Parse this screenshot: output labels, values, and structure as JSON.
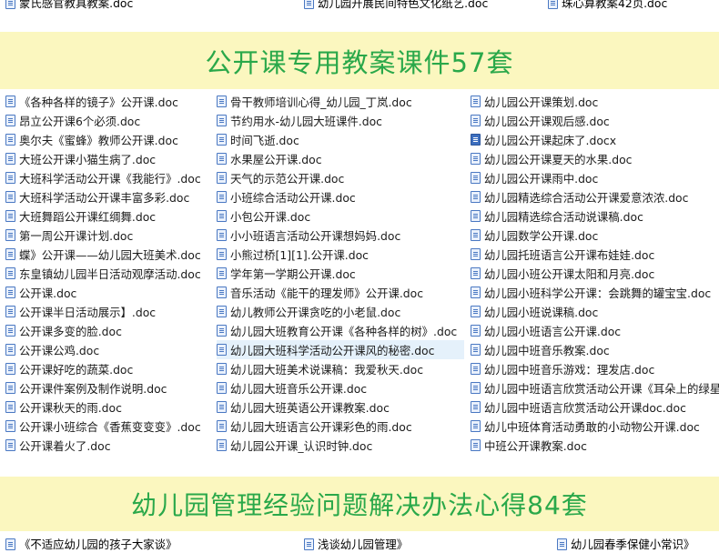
{
  "top_strip": [
    {
      "icon": "doc-file-icon",
      "text": "蒙氏感官教具教案.doc"
    },
    {
      "icon": "doc-file-icon",
      "text": "幼儿园开展民间特色文化纸艺.doc"
    },
    {
      "icon": "doc-file-icon",
      "text": "珠心算教案42页.doc"
    }
  ],
  "section_1": {
    "title": "公开课专用教案课件57套"
  },
  "columns": [
    [
      {
        "icon": "doc-file-icon",
        "text": "《各种各样的镜子》公开课.doc"
      },
      {
        "icon": "doc-file-icon",
        "text": "昂立公开课6个必须.doc"
      },
      {
        "icon": "doc-file-icon",
        "text": "奥尔夫《蜜蜂》教师公开课.doc"
      },
      {
        "icon": "doc-file-icon",
        "text": "大班公开课小猫生病了.doc"
      },
      {
        "icon": "doc-file-icon",
        "text": "大班科学活动公开课《我能行》.doc"
      },
      {
        "icon": "doc-file-icon",
        "text": "大班科学活动公开课丰富多彩.doc"
      },
      {
        "icon": "doc-file-icon",
        "text": "大班舞蹈公开课红绸舞.doc"
      },
      {
        "icon": "doc-file-icon",
        "text": "第一周公开课计划.doc"
      },
      {
        "icon": "doc-file-icon",
        "text": "蝶》公开课——幼儿园大班美术.doc"
      },
      {
        "icon": "doc-file-icon",
        "text": "东皇镇幼儿园半日活动观摩活动.doc"
      },
      {
        "icon": "doc-file-icon",
        "text": "公开课.doc"
      },
      {
        "icon": "doc-file-icon",
        "text": "公开课半日活动展示】.doc"
      },
      {
        "icon": "doc-file-icon",
        "text": "公开课多变的脸.doc"
      },
      {
        "icon": "doc-file-icon",
        "text": "公开课公鸡.doc"
      },
      {
        "icon": "doc-file-icon",
        "text": "公开课好吃的蔬菜.doc"
      },
      {
        "icon": "doc-file-icon",
        "text": "公开课件案例及制作说明.doc"
      },
      {
        "icon": "doc-file-icon",
        "text": "公开课秋天的雨.doc"
      },
      {
        "icon": "doc-file-icon",
        "text": "公开课小班综合《香蕉变变变》.doc"
      },
      {
        "icon": "doc-file-icon",
        "text": "公开课着火了.doc"
      }
    ],
    [
      {
        "icon": "doc-file-icon",
        "text": "骨干教师培训心得_幼儿园_丁岚.doc"
      },
      {
        "icon": "doc-file-icon",
        "text": "节约用水-幼儿园大班课件.doc"
      },
      {
        "icon": "doc-file-icon",
        "text": "时间飞逝.doc"
      },
      {
        "icon": "doc-file-icon",
        "text": "水果屋公开课.doc"
      },
      {
        "icon": "doc-file-icon",
        "text": "天气的示范公开课.doc"
      },
      {
        "icon": "doc-file-icon",
        "text": "小班综合活动公开课.doc"
      },
      {
        "icon": "doc-file-icon",
        "text": "小包公开课.doc"
      },
      {
        "icon": "doc-file-icon",
        "text": "小小班语言活动公开课想妈妈.doc"
      },
      {
        "icon": "doc-file-icon",
        "text": "小熊过桥[1][1].公开课.doc"
      },
      {
        "icon": "doc-file-icon",
        "text": "学年第一学期公开课.doc"
      },
      {
        "icon": "doc-file-icon",
        "text": "音乐活动《能干的理发师》公开课.doc"
      },
      {
        "icon": "doc-file-icon",
        "text": "幼儿教师公开课贪吃的小老鼠.doc"
      },
      {
        "icon": "doc-file-icon",
        "text": "幼儿园大班教育公开课《各种各样的树》.doc"
      },
      {
        "icon": "doc-file-icon",
        "text": "幼儿园大班科学活动公开课风的秘密.doc",
        "selected": true
      },
      {
        "icon": "doc-file-icon",
        "text": "幼儿园大班美术说课稿：我爱秋天.doc"
      },
      {
        "icon": "doc-file-icon",
        "text": "幼儿园大班音乐公开课.doc"
      },
      {
        "icon": "doc-file-icon",
        "text": "幼儿园大班英语公开课教案.doc"
      },
      {
        "icon": "doc-file-icon",
        "text": "幼儿园大班语言公开课彩色的雨.doc"
      },
      {
        "icon": "doc-file-icon",
        "text": "幼儿园公开课_认识时钟.doc"
      }
    ],
    [
      {
        "icon": "doc-file-icon",
        "text": "幼儿园公开课策划.doc"
      },
      {
        "icon": "doc-file-icon",
        "text": "幼儿园公开课观后感.doc"
      },
      {
        "icon": "docx-file-icon",
        "text": "幼儿园公开课起床了.docx"
      },
      {
        "icon": "doc-file-icon",
        "text": "幼儿园公开课夏天的水果.doc"
      },
      {
        "icon": "doc-file-icon",
        "text": "幼儿园公开课雨中.doc"
      },
      {
        "icon": "doc-file-icon",
        "text": "幼儿园精选综合活动公开课爱意浓浓.doc"
      },
      {
        "icon": "doc-file-icon",
        "text": "幼儿园精选综合活动说课稿.doc"
      },
      {
        "icon": "doc-file-icon",
        "text": "幼儿园数学公开课.doc"
      },
      {
        "icon": "doc-file-icon",
        "text": "幼儿园托班语言公开课布娃娃.doc"
      },
      {
        "icon": "doc-file-icon",
        "text": "幼儿园小班公开课太阳和月亮.doc"
      },
      {
        "icon": "doc-file-icon",
        "text": "幼儿园小班科学公开课：会跳舞的罐宝宝.doc"
      },
      {
        "icon": "doc-file-icon",
        "text": "幼儿园小班说课稿.doc"
      },
      {
        "icon": "doc-file-icon",
        "text": "幼儿园小班语言公开课.doc"
      },
      {
        "icon": "doc-file-icon",
        "text": "幼儿园中班音乐教案.doc"
      },
      {
        "icon": "doc-file-icon",
        "text": "幼儿园中班音乐游戏：理发店.doc"
      },
      {
        "icon": "doc-file-icon",
        "text": "幼儿园中班语言欣赏活动公开课《耳朵上的绿星"
      },
      {
        "icon": "doc-file-icon",
        "text": "幼儿园中班语言欣赏活动公开课doc.doc"
      },
      {
        "icon": "doc-file-icon",
        "text": "幼儿中班体育活动勇敢的小动物公开课.doc"
      },
      {
        "icon": "doc-file-icon",
        "text": "中班公开课教案.doc"
      }
    ]
  ],
  "section_2": {
    "title": "幼儿园管理经验问题解决办法心得84套"
  },
  "bottom_strip": [
    {
      "icon": "doc-file-icon",
      "text": "《不适应幼儿园的孩子大家谈》"
    },
    {
      "icon": "doc-file-icon",
      "text": "浅谈幼儿园管理》"
    },
    {
      "icon": "doc-file-icon",
      "text": "幼儿园春季保健小常识》"
    }
  ],
  "colors": {
    "banner_bg": "#fbf7bf",
    "banner_text": "#2aa84a",
    "selected_row": "#e5f1fb",
    "icon_blue": "#4a78c2"
  }
}
